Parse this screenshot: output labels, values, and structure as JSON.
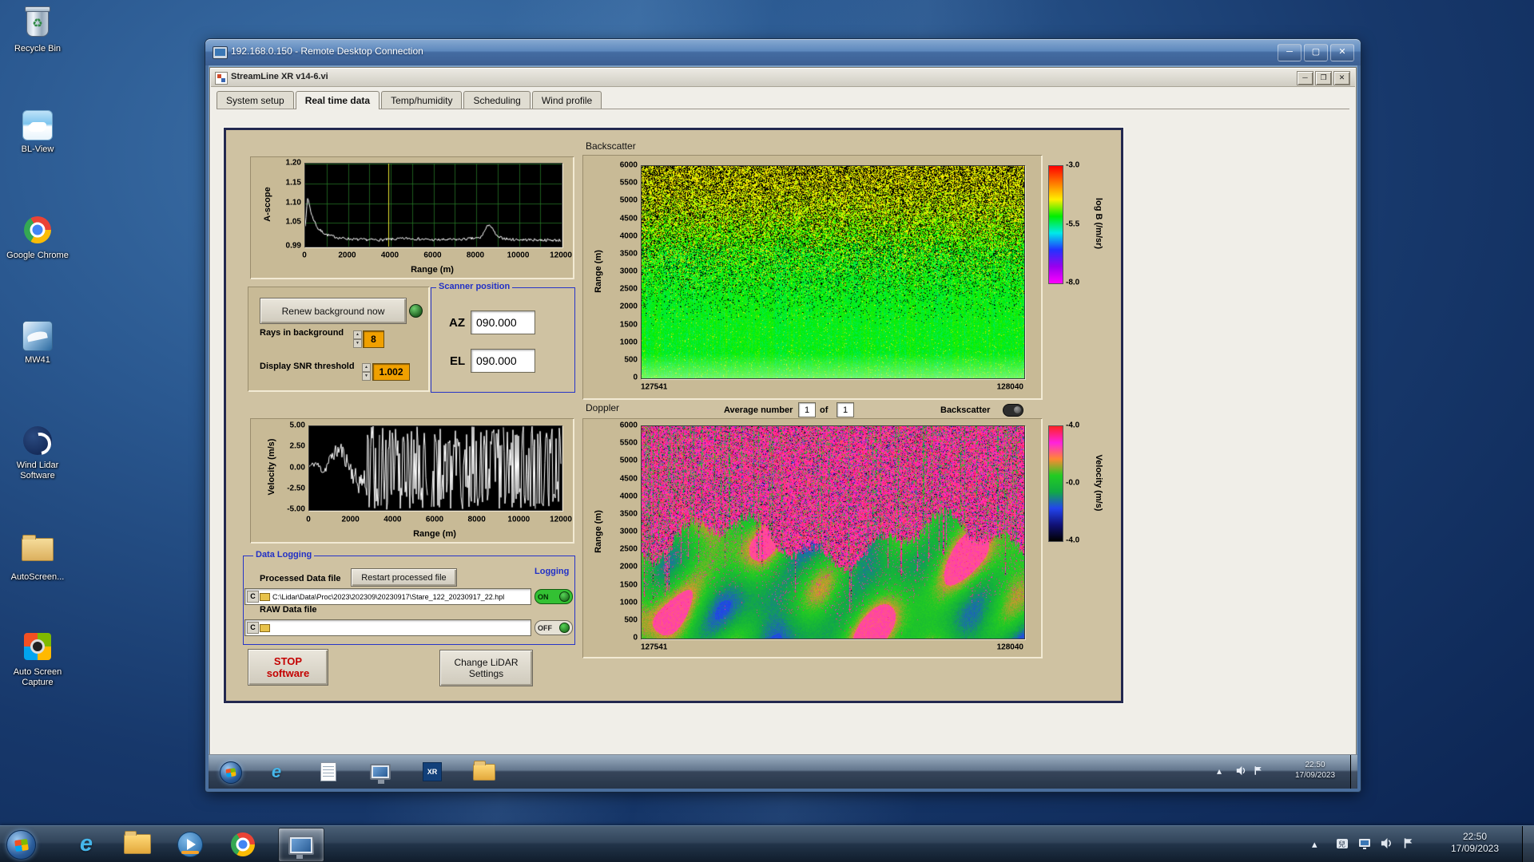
{
  "desktop": {
    "icons": [
      {
        "label": "Recycle Bin"
      },
      {
        "label": "BL-View"
      },
      {
        "label": "Google Chrome"
      },
      {
        "label": "MW41"
      },
      {
        "label": "Wind Lidar Software"
      },
      {
        "label": "AutoScreen..."
      },
      {
        "label": "Auto Screen Capture"
      }
    ]
  },
  "rdp": {
    "title": "192.168.0.150 - Remote Desktop Connection"
  },
  "app": {
    "title": "StreamLine XR v14-6.vi",
    "tabs": [
      "System setup",
      "Real time data",
      "Temp/humidity",
      "Scheduling",
      "Wind profile"
    ],
    "active_tab": "Real time data",
    "renew_button": "Renew background now",
    "rays_label": "Rays in background",
    "rays_value": "8",
    "snr_label": "Display SNR threshold",
    "snr_value": "1.002",
    "scanner": {
      "title": "Scanner position",
      "az_label": "AZ",
      "az_value": "090.000",
      "el_label": "EL",
      "el_value": "090.000"
    },
    "average_label": "Average number",
    "average_value": "1",
    "of_label": "of",
    "of_value": "1",
    "backscatter_toggle_label": "Backscatter",
    "logging": {
      "group_title": "Data Logging",
      "processed_label": "Processed Data file",
      "restart_button": "Restart processed file",
      "logging_label": "Logging",
      "drive_prefix": "C",
      "processed_path": "C:\\Lidar\\Data\\Proc\\2023\\202309\\20230917\\Stare_122_20230917_22.hpl",
      "on_label": "ON",
      "raw_label": "RAW Data file",
      "raw_path": "",
      "off_label": "OFF"
    },
    "stop_button_line1": "STOP",
    "stop_button_line2": "software",
    "change_button_line1": "Change LiDAR",
    "change_button_line2": "Settings"
  },
  "remote_taskbar": {
    "clock_time": "22:50",
    "clock_date": "17/09/2023"
  },
  "host_taskbar": {
    "clock_time": "22:50",
    "clock_date": "17/09/2023"
  },
  "chart_data": [
    {
      "id": "ascope",
      "type": "line",
      "title": "",
      "xlabel": "Range (m)",
      "ylabel": "A-scope",
      "xlim": [
        0,
        12000
      ],
      "ylim": [
        0.99,
        1.2
      ],
      "xticks": [
        0,
        2000,
        4000,
        6000,
        8000,
        10000,
        12000
      ],
      "yticks": [
        "1.20",
        "1.15",
        "1.10",
        "1.05",
        "0.99"
      ],
      "ytick_vals": [
        1.2,
        1.15,
        1.1,
        1.05,
        0.99
      ],
      "cursor_x": 3900,
      "grid": true,
      "profile": [
        [
          0,
          1.045
        ],
        [
          120,
          1.115
        ],
        [
          300,
          1.07
        ],
        [
          600,
          1.035
        ],
        [
          1000,
          1.02
        ],
        [
          1600,
          1.012
        ],
        [
          2400,
          1.008
        ],
        [
          3600,
          1.007
        ],
        [
          4800,
          1.011
        ],
        [
          6000,
          1.007
        ],
        [
          7200,
          1.008
        ],
        [
          8200,
          1.012
        ],
        [
          8600,
          1.048
        ],
        [
          9000,
          1.014
        ],
        [
          9600,
          1.008
        ],
        [
          10800,
          1.007
        ],
        [
          12000,
          1.006
        ]
      ],
      "noise": 0.0035,
      "seed": 7,
      "line_color": "#ffffff",
      "cursor_color": "#e8e832",
      "bg": "#000000"
    },
    {
      "id": "velocity",
      "type": "line",
      "title": "",
      "xlabel": "Range (m)",
      "ylabel": "Velocity (m/s)",
      "xlim": [
        0,
        12000
      ],
      "ylim": [
        -5,
        5
      ],
      "xticks": [
        0,
        2000,
        4000,
        6000,
        8000,
        10000,
        12000
      ],
      "yticks": [
        "5.00",
        "2.50",
        "0.00",
        "-2.50",
        "-5.00"
      ],
      "ytick_vals": [
        5,
        2.5,
        0,
        -2.5,
        -5
      ],
      "coherent_until": 2700,
      "profile": [
        [
          0,
          0.2
        ],
        [
          300,
          0.6
        ],
        [
          700,
          -0.4
        ],
        [
          1100,
          1.6
        ],
        [
          1500,
          2.3
        ],
        [
          1900,
          0.3
        ],
        [
          2300,
          -1.8
        ],
        [
          2700,
          -1.2
        ]
      ],
      "seed": 11,
      "line_color": "#ffffff",
      "bg": "#000000"
    },
    {
      "id": "backscatter",
      "type": "heatmap",
      "title": "Backscatter",
      "ylabel": "Range (m)",
      "ylim": [
        0,
        6000
      ],
      "x_start_label": "127541",
      "x_end_label": "128040",
      "yticks": [
        6000,
        5500,
        5000,
        4500,
        4000,
        3500,
        3000,
        2500,
        2000,
        1500,
        1000,
        500,
        0
      ],
      "colorbar": {
        "label": "log B (/m/sr)",
        "ticks": [
          "-3.0",
          "-5.5",
          "-8.0"
        ],
        "stops": [
          "#ff0000",
          "#ff7700",
          "#ffee00",
          "#00ee00",
          "#00eaea",
          "#2233ff",
          "#9900ee",
          "#ff00ff"
        ]
      },
      "regions": "smooth bright green boundary layer below ~2500 m; speckled yellow-green and black uncorrelated noise aloft, density increasing with height",
      "seed": 23
    },
    {
      "id": "doppler",
      "type": "heatmap",
      "title": "Doppler",
      "ylabel": "Range (m)",
      "ylim": [
        0,
        6000
      ],
      "x_start_label": "127541",
      "x_end_label": "128040",
      "yticks": [
        6000,
        5500,
        5000,
        4500,
        4000,
        3500,
        3000,
        2500,
        2000,
        1500,
        1000,
        500,
        0
      ],
      "colorbar": {
        "label": "Velocity (m/s)",
        "ticks": [
          "-4.0",
          "-0.0",
          "-4.0"
        ],
        "stops": [
          "#ff2222",
          "#ff22dd",
          "#ff8833",
          "#22cc22",
          "#11aa44",
          "#2244ee",
          "#111177",
          "#000000"
        ]
      },
      "regions": "magenta/pink uncorrelated noise above ~2800 m with vertical green streaks; turbulent green field with red and blue patches below",
      "seed": 41
    }
  ]
}
